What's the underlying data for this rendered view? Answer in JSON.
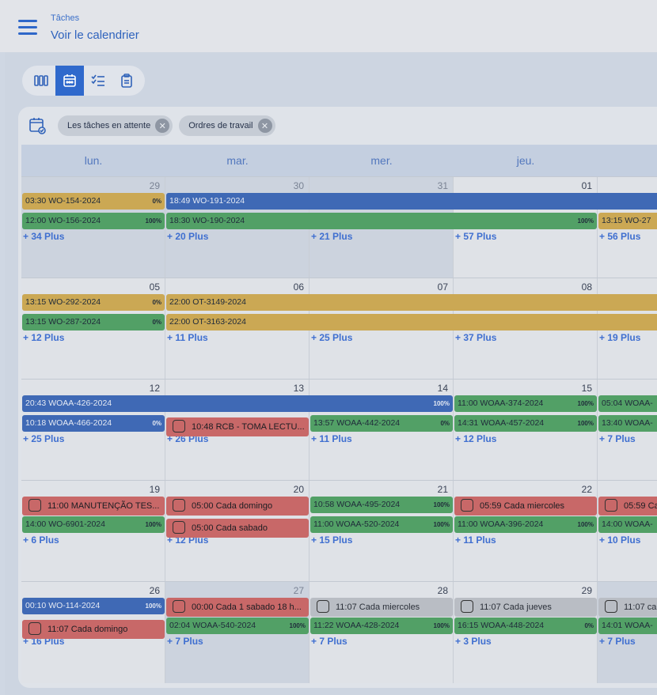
{
  "header": {
    "app": "Tâches",
    "title": "Voir le calendrier"
  },
  "views": [
    "columns-icon",
    "calendar-icon",
    "checklist-icon",
    "clipboard-icon"
  ],
  "filters": [
    "Les tâches en attente",
    "Ordres de travail"
  ],
  "weekdays": [
    "lun.",
    "mar.",
    "mer.",
    "jeu."
  ],
  "weeks": [
    {
      "days": [
        "29",
        "30",
        "31",
        "01",
        ""
      ],
      "events": [
        {
          "t": "03:30 WO-154-2024",
          "p": "0%"
        },
        {
          "t": "12:00 WO-156-2024",
          "p": "100%"
        },
        {
          "t": "18:49 WO-191-2024",
          "p": ""
        },
        {
          "t": "18:30 WO-190-2024",
          "p": "100%"
        },
        {
          "t": "13:15 WO-27",
          "p": ""
        }
      ],
      "more": [
        "+ 34 Plus",
        "+ 20 Plus",
        "+ 21 Plus",
        "+ 57 Plus",
        "+ 56 Plus"
      ]
    },
    {
      "days": [
        "05",
        "06",
        "07",
        "08",
        ""
      ],
      "events": [
        {
          "t": "13:15 WO-292-2024",
          "p": "0%"
        },
        {
          "t": "13:15 WO-287-2024",
          "p": "0%"
        },
        {
          "t": "22:00 OT-3149-2024",
          "p": ""
        },
        {
          "t": "22:00 OT-3163-2024",
          "p": ""
        }
      ],
      "more": [
        "+ 12 Plus",
        "+ 11 Plus",
        "+ 25 Plus",
        "+ 37 Plus",
        "+ 19 Plus"
      ]
    },
    {
      "days": [
        "12",
        "13",
        "14",
        "15",
        ""
      ],
      "events": [
        {
          "t": "20:43 WOAA-426-2024",
          "p": "100%"
        },
        {
          "t": "11:00 WOAA-374-2024",
          "p": "100%"
        },
        {
          "t": "05:04 WOAA-",
          "p": ""
        },
        {
          "t": "10:18 WOAA-466-2024",
          "p": "0%"
        },
        {
          "t": "10:48 RCB - TOMA LECTU...",
          "p": ""
        },
        {
          "t": "13:57 WOAA-442-2024",
          "p": "0%"
        },
        {
          "t": "14:31 WOAA-457-2024",
          "p": "100%"
        },
        {
          "t": "13:40 WOAA-",
          "p": ""
        }
      ],
      "more": [
        "+ 25 Plus",
        "+ 26 Plus",
        "+ 11 Plus",
        "+ 12 Plus",
        "+ 7 Plus"
      ]
    },
    {
      "days": [
        "19",
        "20",
        "21",
        "22",
        ""
      ],
      "events": [
        {
          "t": "11:00 MANUTENÇÃO TES...",
          "p": ""
        },
        {
          "t": "05:00 Cada domingo",
          "p": ""
        },
        {
          "t": "10:58 WOAA-495-2024",
          "p": "100%"
        },
        {
          "t": "05:59 Cada miercoles",
          "p": ""
        },
        {
          "t": "05:59 Ca",
          "p": ""
        },
        {
          "t": "14:00 WO-6901-2024",
          "p": "100%"
        },
        {
          "t": "05:00 Cada sabado",
          "p": ""
        },
        {
          "t": "11:00 WOAA-520-2024",
          "p": "100%"
        },
        {
          "t": "11:00 WOAA-396-2024",
          "p": "100%"
        },
        {
          "t": "14:00 WOAA-",
          "p": ""
        }
      ],
      "more": [
        "+ 6 Plus",
        "+ 12 Plus",
        "+ 15 Plus",
        "+ 11 Plus",
        "+ 10 Plus"
      ]
    },
    {
      "days": [
        "26",
        "27",
        "28",
        "29",
        ""
      ],
      "events": [
        {
          "t": "00:10 WO-114-2024",
          "p": "100%"
        },
        {
          "t": "00:00 Cada 1 sabado 18 h...",
          "p": ""
        },
        {
          "t": "11:07 Cada miercoles",
          "p": ""
        },
        {
          "t": "11:07 Cada jueves",
          "p": ""
        },
        {
          "t": "11:07 ca",
          "p": ""
        },
        {
          "t": "11:07 Cada domingo",
          "p": ""
        },
        {
          "t": "02:04 WOAA-540-2024",
          "p": "100%"
        },
        {
          "t": "11:22 WOAA-428-2024",
          "p": "100%"
        },
        {
          "t": "16:15 WOAA-448-2024",
          "p": "0%"
        },
        {
          "t": "14:01 WOAA-",
          "p": ""
        }
      ],
      "more": [
        "+ 16 Plus",
        "+ 7 Plus",
        "+ 7 Plus",
        "+ 3 Plus",
        "+ 7 Plus"
      ]
    }
  ]
}
